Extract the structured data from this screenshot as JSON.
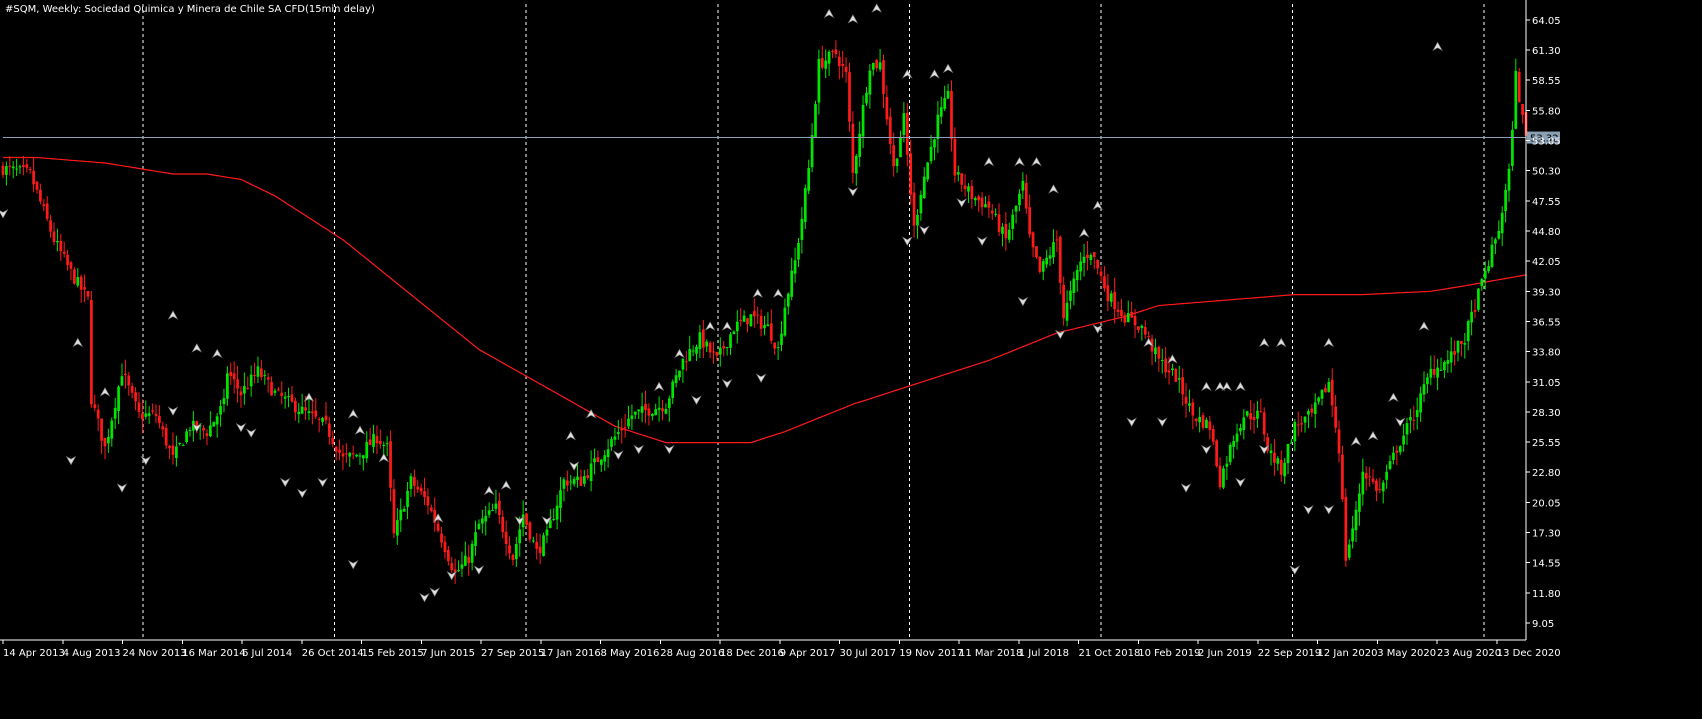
{
  "chart_data": {
    "type": "candlestick",
    "title": "#SQM, Weekly:  Sociedad Quimica y Minera de Chile SA CFD(15min delay)",
    "timeframe": "Weekly",
    "ylim": [
      7.5,
      65.5
    ],
    "y_ticks": [
      "64.05",
      "61.30",
      "58.55",
      "55.80",
      "53.05",
      "50.30",
      "47.55",
      "44.80",
      "42.05",
      "39.30",
      "36.55",
      "33.80",
      "31.05",
      "28.30",
      "25.55",
      "22.80",
      "20.05",
      "17.30",
      "14.55",
      "11.80",
      "9.05"
    ],
    "current_price": "53.32",
    "x_ticks": [
      "14 Apr 2013",
      "4 Aug 2013",
      "24 Nov 2013",
      "16 Mar 2014",
      "6 Jul 2014",
      "26 Oct 2014",
      "15 Feb 2015",
      "7 Jun 2015",
      "27 Sep 2015",
      "17 Jan 2016",
      "8 May 2016",
      "28 Aug 2016",
      "18 Dec 2016",
      "9 Apr 2017",
      "30 Jul 2017",
      "19 Nov 2017",
      "11 Mar 2018",
      "1 Jul 2018",
      "21 Oct 2018",
      "10 Feb 2019",
      "2 Jun 2019",
      "22 Sep 2019",
      "12 Jan 2020",
      "3 May 2020",
      "23 Aug 2020",
      "13 Dec 2020"
    ],
    "close_path": [
      [
        0,
        50.5
      ],
      [
        8,
        50
      ],
      [
        15,
        44
      ],
      [
        20,
        41
      ],
      [
        25,
        38.5
      ],
      [
        26,
        29.5
      ],
      [
        30,
        25
      ],
      [
        35,
        32
      ],
      [
        40,
        28
      ],
      [
        45,
        28
      ],
      [
        50,
        24
      ],
      [
        55,
        27
      ],
      [
        60,
        26.5
      ],
      [
        65,
        29
      ],
      [
        66,
        32
      ],
      [
        70,
        30
      ],
      [
        75,
        32
      ],
      [
        80,
        30
      ],
      [
        85,
        29
      ],
      [
        90,
        28
      ],
      [
        95,
        27
      ],
      [
        100,
        24
      ],
      [
        105,
        24.5
      ],
      [
        110,
        26
      ],
      [
        113,
        25
      ],
      [
        115,
        17
      ],
      [
        120,
        22
      ],
      [
        125,
        20
      ],
      [
        130,
        16
      ],
      [
        133,
        13.5
      ],
      [
        137,
        15
      ],
      [
        140,
        18
      ],
      [
        145,
        19.5
      ],
      [
        150,
        15
      ],
      [
        153,
        19
      ],
      [
        157,
        15.5
      ],
      [
        160,
        17
      ],
      [
        165,
        22
      ],
      [
        170,
        22
      ],
      [
        175,
        24
      ],
      [
        180,
        26
      ],
      [
        185,
        28
      ],
      [
        190,
        28.5
      ],
      [
        195,
        29
      ],
      [
        200,
        33
      ],
      [
        205,
        35
      ],
      [
        210,
        33
      ],
      [
        215,
        36
      ],
      [
        220,
        37
      ],
      [
        225,
        36
      ],
      [
        228,
        34
      ],
      [
        230,
        38
      ],
      [
        233,
        42
      ],
      [
        235,
        46
      ],
      [
        237,
        50.5
      ],
      [
        240,
        60
      ],
      [
        245,
        61
      ],
      [
        248,
        59
      ],
      [
        250,
        50
      ],
      [
        255,
        60
      ],
      [
        258,
        60
      ],
      [
        262,
        50.5
      ],
      [
        265,
        55
      ],
      [
        268,
        45
      ],
      [
        270,
        48.5
      ],
      [
        275,
        55
      ],
      [
        278,
        57
      ],
      [
        280,
        50
      ],
      [
        285,
        48
      ],
      [
        290,
        47
      ],
      [
        295,
        44
      ],
      [
        300,
        49
      ],
      [
        302,
        44
      ],
      [
        305,
        41
      ],
      [
        310,
        44
      ],
      [
        312,
        37
      ],
      [
        317,
        42
      ],
      [
        320,
        43
      ],
      [
        325,
        39
      ],
      [
        330,
        37
      ],
      [
        335,
        36
      ],
      [
        340,
        33
      ],
      [
        345,
        31.5
      ],
      [
        350,
        28
      ],
      [
        355,
        27
      ],
      [
        358,
        22
      ],
      [
        362,
        26
      ],
      [
        365,
        28
      ],
      [
        370,
        28
      ],
      [
        372,
        25
      ],
      [
        376,
        23
      ],
      [
        380,
        27
      ],
      [
        385,
        28
      ],
      [
        390,
        31
      ],
      [
        393,
        25
      ],
      [
        395,
        15
      ],
      [
        398,
        19
      ],
      [
        400,
        23
      ],
      [
        405,
        21
      ],
      [
        410,
        25
      ],
      [
        415,
        28
      ],
      [
        420,
        32
      ],
      [
        425,
        33
      ],
      [
        430,
        35
      ],
      [
        435,
        40
      ],
      [
        440,
        45
      ],
      [
        443,
        50
      ],
      [
        445,
        59
      ],
      [
        447,
        55
      ],
      [
        448,
        53.32
      ]
    ],
    "ma_line": [
      [
        0,
        51.5
      ],
      [
        10,
        51.5
      ],
      [
        30,
        51
      ],
      [
        50,
        50
      ],
      [
        60,
        50
      ],
      [
        70,
        49.5
      ],
      [
        80,
        48
      ],
      [
        100,
        44
      ],
      [
        120,
        39
      ],
      [
        140,
        34
      ],
      [
        160,
        30.5
      ],
      [
        180,
        27
      ],
      [
        195,
        25.5
      ],
      [
        210,
        25.5
      ],
      [
        220,
        25.5
      ],
      [
        230,
        26.5
      ],
      [
        250,
        29
      ],
      [
        270,
        31
      ],
      [
        290,
        33
      ],
      [
        310,
        35.5
      ],
      [
        330,
        37
      ],
      [
        340,
        38
      ],
      [
        360,
        38.5
      ],
      [
        380,
        39
      ],
      [
        400,
        39
      ],
      [
        420,
        39.3
      ],
      [
        430,
        39.8
      ],
      [
        448,
        40.8
      ]
    ],
    "fractal_highs": [
      [
        22,
        34
      ],
      [
        30,
        29.5
      ],
      [
        50,
        36.5
      ],
      [
        57,
        33.5
      ],
      [
        63,
        33
      ],
      [
        90,
        29
      ],
      [
        103,
        27.5
      ],
      [
        105,
        26
      ],
      [
        112,
        23.5
      ],
      [
        128,
        18
      ],
      [
        143,
        20.5
      ],
      [
        148,
        21
      ],
      [
        167,
        25.5
      ],
      [
        173,
        27.5
      ],
      [
        193,
        30
      ],
      [
        199,
        33
      ],
      [
        208,
        35.5
      ],
      [
        213,
        35.5
      ],
      [
        222,
        38.5
      ],
      [
        228,
        38.5
      ],
      [
        243,
        64
      ],
      [
        250,
        63.5
      ],
      [
        257,
        64.5
      ],
      [
        266,
        58.5
      ],
      [
        274,
        58.5
      ],
      [
        278,
        59
      ],
      [
        290,
        50.5
      ],
      [
        299,
        50.5
      ],
      [
        304,
        50.5
      ],
      [
        309,
        48
      ],
      [
        318,
        44
      ],
      [
        322,
        46.5
      ],
      [
        337,
        34
      ],
      [
        344,
        32.5
      ],
      [
        354,
        30
      ],
      [
        358,
        30
      ],
      [
        360,
        30
      ],
      [
        364,
        30
      ],
      [
        371,
        34
      ],
      [
        376,
        34
      ],
      [
        390,
        34
      ],
      [
        398,
        25
      ],
      [
        403,
        25.5
      ],
      [
        409,
        29
      ],
      [
        418,
        35.5
      ],
      [
        422,
        61
      ]
    ],
    "fractal_lows": [
      [
        0,
        47
      ],
      [
        20,
        24.5
      ],
      [
        35,
        22
      ],
      [
        42,
        24.5
      ],
      [
        50,
        29
      ],
      [
        57,
        27.5
      ],
      [
        70,
        27.5
      ],
      [
        73,
        27
      ],
      [
        83,
        22.5
      ],
      [
        88,
        21.5
      ],
      [
        94,
        22.5
      ],
      [
        103,
        15
      ],
      [
        124,
        12
      ],
      [
        127,
        12.5
      ],
      [
        132,
        14
      ],
      [
        140,
        14.5
      ],
      [
        152,
        19
      ],
      [
        160,
        19
      ],
      [
        168,
        24
      ],
      [
        181,
        25
      ],
      [
        187,
        25.5
      ],
      [
        196,
        25.5
      ],
      [
        204,
        30
      ],
      [
        213,
        31.5
      ],
      [
        223,
        32
      ],
      [
        250,
        49
      ],
      [
        266,
        44.5
      ],
      [
        271,
        45.5
      ],
      [
        282,
        48
      ],
      [
        288,
        44.5
      ],
      [
        300,
        39
      ],
      [
        311,
        36
      ],
      [
        322,
        36.5
      ],
      [
        332,
        28
      ],
      [
        341,
        28
      ],
      [
        348,
        22
      ],
      [
        354,
        25.5
      ],
      [
        364,
        22.5
      ],
      [
        371,
        25.5
      ],
      [
        380,
        14.5
      ],
      [
        384,
        20
      ],
      [
        390,
        20
      ],
      [
        411,
        28
      ]
    ]
  }
}
